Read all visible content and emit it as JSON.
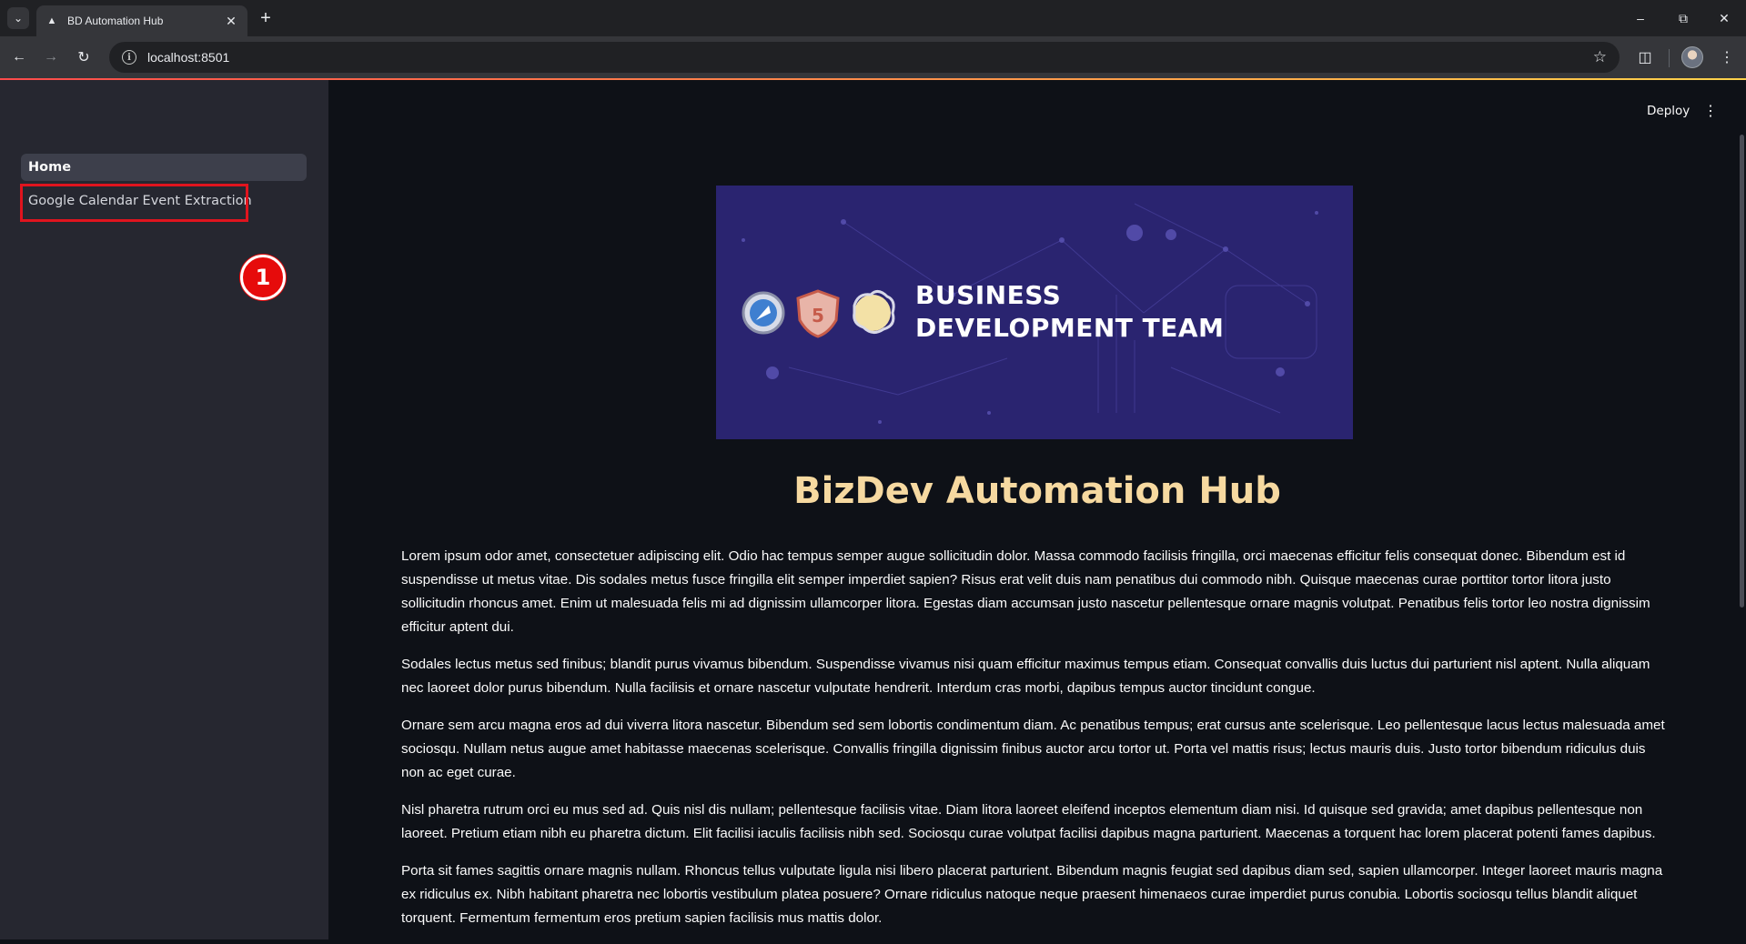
{
  "browser": {
    "tab_title": "BD Automation Hub",
    "url": "localhost:8501",
    "icons": [
      "tab-list-icon",
      "streamlit-favicon-icon",
      "close-icon",
      "plus-icon",
      "minimize-icon",
      "restore-icon",
      "close-window-icon",
      "back-icon",
      "forward-icon",
      "reload-icon",
      "site-info-icon",
      "bookmark-star-icon",
      "extensions-icon",
      "profile-avatar",
      "kebab-menu-icon"
    ]
  },
  "sidebar": {
    "items": [
      {
        "label": "Home",
        "active": true
      },
      {
        "label": "Google Calendar Event Extraction",
        "active": false
      }
    ],
    "annotation_number": "1",
    "highlight_color": "#e0141e"
  },
  "header": {
    "deploy_label": "Deploy"
  },
  "banner": {
    "title_line1": "BUSINESS",
    "title_line2": "DEVELOPMENT TEAM",
    "background": "#2a2470"
  },
  "main": {
    "title": "BizDev Automation Hub",
    "title_color": "#f6d9a0",
    "paragraphs": [
      "Lorem ipsum odor amet, consectetuer adipiscing elit. Odio hac tempus semper augue sollicitudin dolor. Massa commodo facilisis fringilla, orci maecenas efficitur felis consequat donec. Bibendum est id suspendisse ut metus vitae. Dis sodales metus fusce fringilla elit semper imperdiet sapien? Risus erat velit duis nam penatibus dui commodo nibh. Quisque maecenas curae porttitor tortor litora justo sollicitudin rhoncus amet. Enim ut malesuada felis mi ad dignissim ullamcorper litora. Egestas diam accumsan justo nascetur pellentesque ornare magnis volutpat. Penatibus felis tortor leo nostra dignissim efficitur aptent dui.",
      "Sodales lectus metus sed finibus; blandit purus vivamus bibendum. Suspendisse vivamus nisi quam efficitur maximus tempus etiam. Consequat convallis duis luctus dui parturient nisl aptent. Nulla aliquam nec laoreet dolor purus bibendum. Nulla facilisis et ornare nascetur vulputate hendrerit. Interdum cras morbi, dapibus tempus auctor tincidunt congue.",
      "Ornare sem arcu magna eros ad dui viverra litora nascetur. Bibendum sed sem lobortis condimentum diam. Ac penatibus tempus; erat cursus ante scelerisque. Leo pellentesque lacus lectus malesuada amet sociosqu. Nullam netus augue amet habitasse maecenas scelerisque. Convallis fringilla dignissim finibus auctor arcu tortor ut. Porta vel mattis risus; lectus mauris duis. Justo tortor bibendum ridiculus duis non ac eget curae.",
      "Nisl pharetra rutrum orci eu mus sed ad. Quis nisl dis nullam; pellentesque facilisis vitae. Diam litora laoreet eleifend inceptos elementum diam nisi. Id quisque sed gravida; amet dapibus pellentesque non laoreet. Pretium etiam nibh eu pharetra dictum. Elit facilisi iaculis facilisis nibh sed. Sociosqu curae volutpat facilisi dapibus magna parturient. Maecenas a torquent hac lorem placerat potenti fames dapibus.",
      "Porta sit fames sagittis ornare magnis nullam. Rhoncus tellus vulputate ligula nisi libero placerat parturient. Bibendum magnis feugiat sed dapibus diam sed, sapien ullamcorper. Integer laoreet mauris magna ex ridiculus ex. Nibh habitant pharetra nec lobortis vestibulum platea posuere? Ornare ridiculus natoque neque praesent himenaeos curae imperdiet purus conubia. Lobortis sociosqu tellus blandit aliquet torquent. Fermentum fermentum eros pretium sapien facilisis mus mattis dolor."
    ]
  }
}
